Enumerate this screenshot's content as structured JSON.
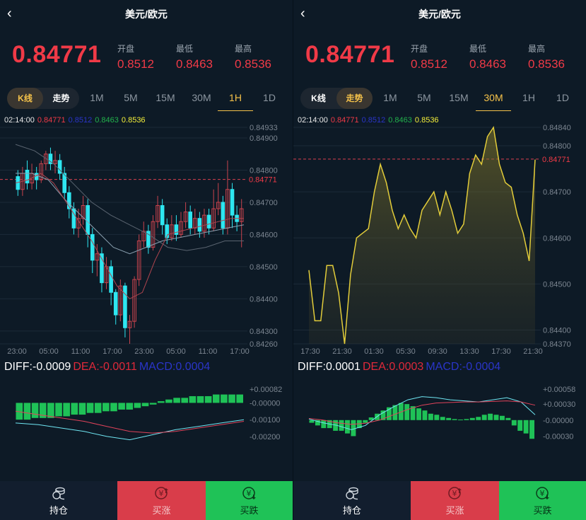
{
  "colors": {
    "up": "#f03a47",
    "down": "#1fc257",
    "accent": "#f5c24a",
    "bg": "#0d1a26"
  },
  "header": {
    "back_icon": "chevron-left-icon",
    "title": "美元/欧元"
  },
  "quote": {
    "price": "0.84771",
    "open_label": "开盘",
    "open": "0.8512",
    "low_label": "最低",
    "low": "0.8463",
    "high_label": "最高",
    "high": "0.8536"
  },
  "tabs": {
    "kline": "K线",
    "trend": "走势",
    "periods": [
      "1M",
      "5M",
      "15M",
      "30M",
      "1H",
      "1D"
    ]
  },
  "left": {
    "mode": "kline",
    "active_period": "1H",
    "info": {
      "time": "02:14:00",
      "price": "0.84771",
      "open": "0.8512",
      "low": "0.8463",
      "high": "0.8536"
    },
    "macd_labels": {
      "diff": "DIFF:-0.0009",
      "dea": "DEA:-0.0011",
      "macd": "MACD:0.0004"
    }
  },
  "right": {
    "mode": "trend",
    "active_period": "30M",
    "info": {
      "time": "02:14:00",
      "price": "0.84771",
      "open": "0.8512",
      "low": "0.8463",
      "high": "0.8536"
    },
    "macd_labels": {
      "diff": "DIFF:0.0001",
      "dea": "DEA:0.0003",
      "macd": "MACD:-0.0004"
    }
  },
  "bottom": {
    "hold_label": "持仓",
    "hold_icon": "coin-stack-icon",
    "buy_up_label": "买涨",
    "buy_up_icon": "yen-up-icon",
    "buy_down_label": "买跌",
    "buy_down_icon": "yen-down-icon"
  },
  "chart_data": [
    {
      "type": "candlestick",
      "name": "kline-1H",
      "x_ticks": [
        "23:00",
        "05:00",
        "11:00",
        "17:00",
        "23:00",
        "05:00",
        "11:00",
        "17:00"
      ],
      "y_ticks": [
        "0.84933",
        "0.84900",
        "0.84800",
        "0.84700",
        "0.84600",
        "0.84500",
        "0.84400",
        "0.84300",
        "0.84260"
      ],
      "ylim": [
        0.8426,
        0.84933
      ],
      "current_price_line": "0.84771",
      "candles": [
        [
          0.8478,
          0.8474,
          0.848,
          0.8472
        ],
        [
          0.8474,
          0.8479,
          0.8481,
          0.8472
        ],
        [
          0.848,
          0.8476,
          0.8483,
          0.8474
        ],
        [
          0.8476,
          0.8479,
          0.8482,
          0.8474
        ],
        [
          0.8479,
          0.8477,
          0.8481,
          0.8474
        ],
        [
          0.8477,
          0.8482,
          0.8483,
          0.8476
        ],
        [
          0.8482,
          0.8485,
          0.8486,
          0.848
        ],
        [
          0.8485,
          0.8482,
          0.8487,
          0.848
        ],
        [
          0.8482,
          0.8483,
          0.8486,
          0.8479
        ],
        [
          0.8483,
          0.8479,
          0.8485,
          0.8477
        ],
        [
          0.8479,
          0.8473,
          0.8481,
          0.8471
        ],
        [
          0.8473,
          0.8468,
          0.8475,
          0.8465
        ],
        [
          0.8468,
          0.8462,
          0.847,
          0.846
        ],
        [
          0.8462,
          0.8465,
          0.8468,
          0.8459
        ],
        [
          0.8465,
          0.8469,
          0.8472,
          0.8463
        ],
        [
          0.8469,
          0.846,
          0.8471,
          0.8456
        ],
        [
          0.846,
          0.8452,
          0.8462,
          0.8448
        ],
        [
          0.8452,
          0.8454,
          0.8457,
          0.8447
        ],
        [
          0.8454,
          0.8445,
          0.8456,
          0.8442
        ],
        [
          0.8445,
          0.845,
          0.8453,
          0.8443
        ],
        [
          0.845,
          0.8442,
          0.8452,
          0.8438
        ],
        [
          0.8442,
          0.8435,
          0.8443,
          0.8432
        ],
        [
          0.8435,
          0.8444,
          0.8446,
          0.8433
        ],
        [
          0.8444,
          0.8431,
          0.8445,
          0.8428
        ],
        [
          0.8431,
          0.8433,
          0.8435,
          0.8426
        ],
        [
          0.8433,
          0.8446,
          0.8447,
          0.8431
        ],
        [
          0.8446,
          0.8458,
          0.846,
          0.8444
        ],
        [
          0.8458,
          0.8461,
          0.8464,
          0.8456
        ],
        [
          0.8461,
          0.8456,
          0.8463,
          0.8454
        ],
        [
          0.8456,
          0.8464,
          0.8466,
          0.8455
        ],
        [
          0.8464,
          0.8469,
          0.8472,
          0.8462
        ],
        [
          0.8469,
          0.8463,
          0.8471,
          0.846
        ],
        [
          0.8463,
          0.8459,
          0.8465,
          0.8457
        ],
        [
          0.8459,
          0.8463,
          0.8466,
          0.8458
        ],
        [
          0.8463,
          0.846,
          0.8466,
          0.8458
        ],
        [
          0.846,
          0.8464,
          0.8467,
          0.8459
        ],
        [
          0.8464,
          0.8467,
          0.847,
          0.8462
        ],
        [
          0.8467,
          0.8462,
          0.8469,
          0.846
        ],
        [
          0.8462,
          0.8465,
          0.8468,
          0.846
        ],
        [
          0.8465,
          0.8461,
          0.8467,
          0.8459
        ],
        [
          0.8461,
          0.8466,
          0.8468,
          0.8459
        ],
        [
          0.8466,
          0.8462,
          0.8468,
          0.846
        ],
        [
          0.8462,
          0.8468,
          0.8474,
          0.8461
        ],
        [
          0.8468,
          0.847,
          0.8476,
          0.8466
        ],
        [
          0.847,
          0.8462,
          0.8472,
          0.846
        ],
        [
          0.8462,
          0.8474,
          0.8483,
          0.846
        ],
        [
          0.8474,
          0.8466,
          0.8476,
          0.8462
        ],
        [
          0.8466,
          0.8464,
          0.8469,
          0.8461
        ],
        [
          0.8464,
          0.8468,
          0.8471,
          0.8456
        ]
      ],
      "ma_fast": [
        0.8476,
        0.8477,
        0.8479,
        0.8476,
        0.847,
        0.8464,
        0.8458,
        0.8451,
        0.8444,
        0.844,
        0.8442,
        0.8452,
        0.846,
        0.8461,
        0.8462,
        0.8463,
        0.8464,
        0.8465,
        0.8465
      ],
      "ma_mid": [
        0.8479,
        0.8479,
        0.8477,
        0.8471,
        0.8466,
        0.8461,
        0.8456,
        0.8454,
        0.8456,
        0.8458,
        0.8459,
        0.846,
        0.8461,
        0.8462,
        0.8463
      ],
      "ma_slow": [
        0.8488,
        0.8486,
        0.8482,
        0.8476,
        0.847,
        0.8466,
        0.8463,
        0.846,
        0.8456,
        0.8455,
        0.8456,
        0.8458,
        0.8458
      ],
      "macd": {
        "y_ticks": [
          "+0.00082",
          "-0.00000",
          "-0.00100",
          "-0.00200"
        ],
        "ylim": [
          -0.0023,
          0.00082
        ],
        "bars": [
          -0.001,
          -0.001,
          -0.0009,
          -0.0009,
          -0.0009,
          -0.0008,
          -0.0008,
          -0.0007,
          -0.0007,
          -0.0006,
          -0.0006,
          -0.0005,
          -0.0005,
          -0.0004,
          -0.0004,
          -0.0003,
          -0.0002,
          -0.0001,
          0.0001,
          0.0002,
          0.0003,
          0.0003,
          0.0004,
          0.0004,
          0.0004,
          0.0005,
          0.0005,
          0.0005,
          0.0005
        ],
        "diff": [
          -0.0012,
          -0.0013,
          -0.0015,
          -0.0017,
          -0.002,
          -0.0022,
          -0.0019,
          -0.0016,
          -0.0014,
          -0.0012,
          -0.001
        ],
        "dea": [
          -0.0005,
          -0.0007,
          -0.0009,
          -0.0011,
          -0.0014,
          -0.0017,
          -0.0018,
          -0.0017,
          -0.0015,
          -0.0013,
          -0.0011
        ]
      }
    },
    {
      "type": "area",
      "name": "trend-30M",
      "x_ticks": [
        "17:30",
        "21:30",
        "01:30",
        "05:30",
        "09:30",
        "13:30",
        "17:30",
        "21:30"
      ],
      "y_ticks": [
        "0.84840",
        "0.84800",
        "0.84700",
        "0.84600",
        "0.84500",
        "0.84400",
        "0.84370"
      ],
      "ylim": [
        0.8437,
        0.8484
      ],
      "current_price_line": "0.84771",
      "values": [
        0.8453,
        0.8442,
        0.8442,
        0.8454,
        0.8454,
        0.8448,
        0.8437,
        0.8452,
        0.846,
        0.8461,
        0.8462,
        0.847,
        0.8476,
        0.8472,
        0.8466,
        0.8462,
        0.8465,
        0.8462,
        0.846,
        0.8466,
        0.8468,
        0.847,
        0.8465,
        0.847,
        0.8466,
        0.8461,
        0.8463,
        0.8474,
        0.8478,
        0.8476,
        0.8482,
        0.8484,
        0.8476,
        0.8472,
        0.8471,
        0.8465,
        0.8461,
        0.8455,
        0.8477
      ],
      "macd": {
        "y_ticks": [
          "+0.00058",
          "+0.00030",
          "-0.00000",
          "-0.00030"
        ],
        "ylim": [
          -0.0004,
          0.00058
        ],
        "bars": [
          -5e-05,
          -0.0001,
          -0.00015,
          -0.00015,
          -0.0002,
          -0.0002,
          -0.00025,
          -0.0003,
          -0.00015,
          -5e-05,
          5e-05,
          0.00012,
          0.00018,
          0.00024,
          0.00028,
          0.00032,
          0.0003,
          0.00026,
          0.00022,
          0.00018,
          0.00012,
          0.0001,
          6e-05,
          4e-05,
          2e-05,
          1e-05,
          2e-05,
          4e-05,
          6e-05,
          0.0001,
          0.00012,
          0.0001,
          8e-05,
          4e-05,
          -0.0001,
          -0.0002,
          -0.00025,
          -0.00035
        ],
        "diff": [
          2e-05,
          -5e-05,
          -0.0001,
          -0.00018,
          -0.0001,
          0.0001,
          0.00025,
          0.00038,
          0.00044,
          0.00042,
          0.00038,
          0.00036,
          0.00034,
          0.00038,
          0.00042,
          0.00034,
          0.0001
        ],
        "dea": [
          3e-05,
          0.0,
          -5e-05,
          -8e-05,
          -6e-05,
          0.0,
          0.0001,
          0.0002,
          0.00028,
          0.00032,
          0.00033,
          0.00034,
          0.00034,
          0.00035,
          0.00036,
          0.00034,
          0.00028
        ]
      }
    }
  ]
}
